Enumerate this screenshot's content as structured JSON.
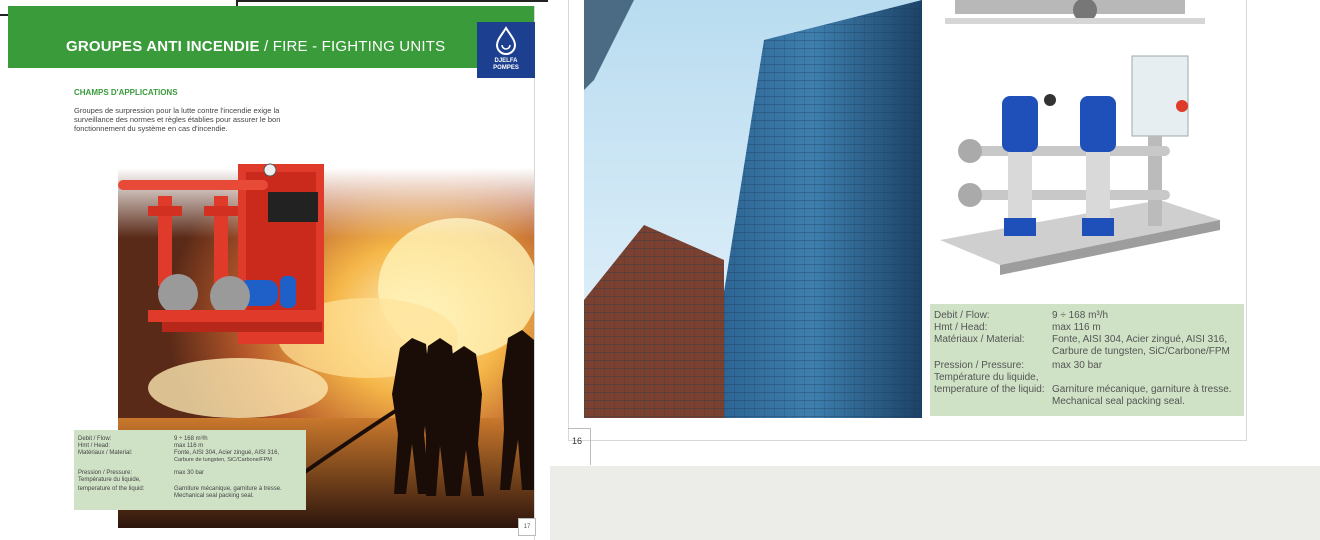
{
  "left_page": {
    "header": {
      "title_fr": "GROUPES ANTI INCENDIE",
      "title_sep": " / ",
      "title_en": "FIRE - FIGHTING UNITS",
      "logo_line1": "DJELFA",
      "logo_line2": "POMPES"
    },
    "section_heading": "CHAMPS D'APPLICATIONS",
    "intro_text": "Groupes de surpression pour la lutte contre l'incendie exige la surveillance des normes et règles établies pour assurer le bon fonctionnement du système en cas d'incendie.",
    "specs": {
      "flow_label": "Debit / Flow:",
      "flow_value": "9 ÷ 168 m³/h",
      "head_label": "Hmt / Head:",
      "head_value": "max 116 m",
      "material_label": "Matériaux / Material:",
      "material_value_1": "Fonte, AISI 304, Acier zingué, AISI 316,",
      "material_value_2": "Carbure de tungsten, SiC/Carbone/FPM",
      "pressure_label": "Pression / Pressure:",
      "pressure_value": "max 30 bar",
      "temp_label_1": "Température du liquide,",
      "temp_label_2": "temperature of the liquid:",
      "seal_value_1": "Garniture mécanique, garniture à tresse.",
      "seal_value_2": "Mechanical seal packing seal."
    },
    "page_number": "17"
  },
  "right_page": {
    "specs": {
      "flow_label": "Debit / Flow:",
      "flow_value": "9 ÷ 168 m³/h",
      "head_label": "Hmt / Head:",
      "head_value": "max 116 m",
      "material_label": "Matériaux / Material:",
      "material_value_1": "Fonte, AISI 304, Acier zingué, AISI 316,",
      "material_value_2": "Carbure de tungsten, SiC/Carbone/FPM",
      "pressure_label": "Pression / Pressure:",
      "pressure_value": "max 30 bar",
      "temp_label_1": "Température du liquide,",
      "temp_label_2": "temperature of the liquid:",
      "seal_value_1": "Garniture mécanique, garniture à tresse.",
      "seal_value_2": "Mechanical seal packing seal."
    },
    "page_number": "16"
  },
  "colors": {
    "header_green": "#3a9b3a",
    "spec_box_green": "#cfe2c6",
    "logo_blue": "#1d3f8f",
    "pump_red": "#e03a2a",
    "pump_blue": "#1f4fb8"
  }
}
